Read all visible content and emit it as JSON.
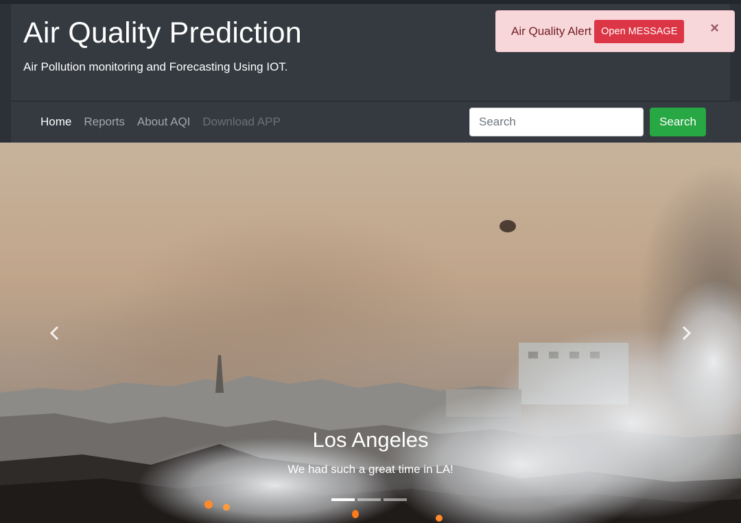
{
  "header": {
    "title": "Air Quality Prediction",
    "subtitle": "Air Pollution monitoring and Forecasting Using IOT."
  },
  "nav": {
    "items": [
      {
        "label": "Home",
        "state": "active"
      },
      {
        "label": "Reports",
        "state": "normal"
      },
      {
        "label": "About AQI",
        "state": "normal"
      },
      {
        "label": "Download APP",
        "state": "disabled"
      }
    ],
    "search_placeholder": "Search",
    "search_button": "Search"
  },
  "alert": {
    "text": "Air Quality Alert",
    "button": "Open MESSAGE",
    "close": "×"
  },
  "carousel": {
    "caption_title": "Los Angeles",
    "caption_text": "We had such a great time in LA!",
    "slide_count": 3,
    "active_slide": 1,
    "prev_icon": "chevron-left-icon",
    "next_icon": "chevron-right-icon"
  },
  "colors": {
    "header_bg": "#343a40",
    "search_button": "#28a745",
    "alert_bg": "#f8d7da",
    "alert_button": "#dc3545"
  }
}
